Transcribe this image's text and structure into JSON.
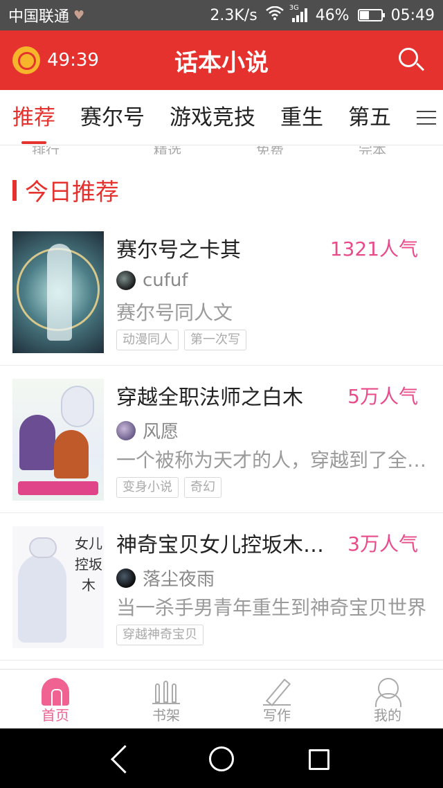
{
  "status_bar": {
    "carrier": "中国联通",
    "net_speed": "2.3K/s",
    "network_type": "3G",
    "battery": "46%",
    "battery_level": 0.46,
    "time": "05:49"
  },
  "app_bar": {
    "timer": "49:39",
    "title": "话本小说"
  },
  "tabs": [
    {
      "label": "推荐",
      "active": true
    },
    {
      "label": "赛尔号",
      "active": false
    },
    {
      "label": "游戏竞技",
      "active": false
    },
    {
      "label": "重生",
      "active": false
    },
    {
      "label": "第五",
      "active": false
    }
  ],
  "sub_nav": [
    "排行",
    "精选",
    "免费",
    "完本"
  ],
  "section": {
    "title": "今日推荐"
  },
  "books": [
    {
      "title": "赛尔号之卡其",
      "popularity": "1321人气",
      "author": "cufuf",
      "description": "赛尔号同人文",
      "tags": [
        "动漫同人",
        "第一次写"
      ]
    },
    {
      "title": "穿越全职法师之白木",
      "popularity": "5万人气",
      "author": "风愿",
      "description": "一个被称为天才的人，穿越到了全职法师世界",
      "tags": [
        "变身小说",
        "奇幻"
      ]
    },
    {
      "title": "神奇宝贝女儿控坂木老爹",
      "popularity": "3万人气",
      "author": "落尘夜雨",
      "description": "当一杀手男青年重生到神奇宝贝世界",
      "tags": [
        "穿越神奇宝贝"
      ]
    }
  ],
  "cover_text": {
    "book3": "女儿控坂木"
  },
  "bottom_nav": [
    {
      "label": "首页",
      "icon": "home-icon",
      "active": true
    },
    {
      "label": "书架",
      "icon": "bookshelf-icon",
      "active": false
    },
    {
      "label": "写作",
      "icon": "pencil-icon",
      "active": false
    },
    {
      "label": "我的",
      "icon": "profile-icon",
      "active": false
    }
  ],
  "colors": {
    "brand_red": "#e6322e",
    "popularity_pink": "#e94b8a",
    "nav_active_pink": "#f06292"
  }
}
